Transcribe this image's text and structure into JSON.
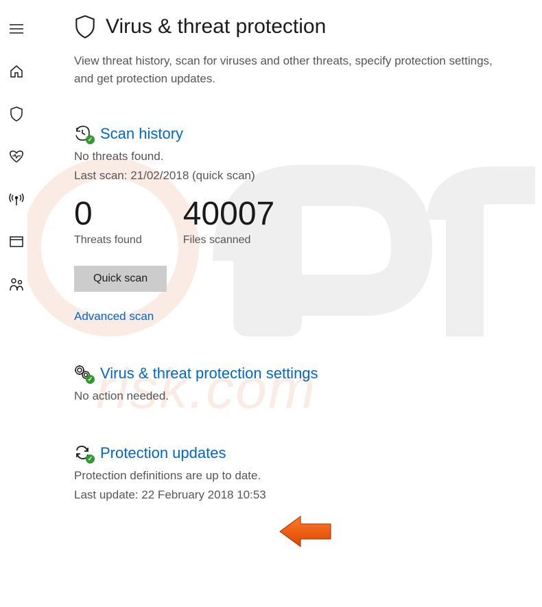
{
  "sidebar": {
    "items": [
      {
        "name": "menu"
      },
      {
        "name": "home"
      },
      {
        "name": "virus-protection"
      },
      {
        "name": "device-performance"
      },
      {
        "name": "firewall"
      },
      {
        "name": "app-browser"
      },
      {
        "name": "family"
      }
    ]
  },
  "header": {
    "title": "Virus & threat protection",
    "description": "View threat history, scan for viruses and other threats, specify protection settings, and get protection updates."
  },
  "scan_history": {
    "title": "Scan history",
    "status": "No threats found.",
    "last_scan": "Last scan: 21/02/2018 (quick scan)",
    "threats_found_value": "0",
    "threats_found_label": "Threats found",
    "files_scanned_value": "40007",
    "files_scanned_label": "Files scanned",
    "quick_scan_button": "Quick scan",
    "advanced_scan_link": "Advanced scan"
  },
  "settings": {
    "title": "Virus & threat protection settings",
    "status": "No action needed."
  },
  "updates": {
    "title": "Protection updates",
    "status": "Protection definitions are up to date.",
    "last_update": "Last update: 22 February 2018 10:53"
  },
  "watermark": {
    "text": "risk.com"
  }
}
